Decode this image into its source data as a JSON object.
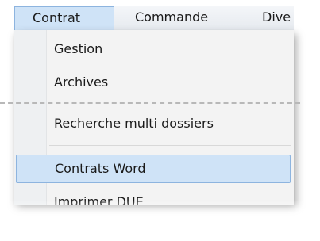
{
  "menubar": {
    "items": [
      {
        "label": "Contrat",
        "active": true
      },
      {
        "label": "Commande",
        "active": false
      },
      {
        "label": "Dive",
        "active": false
      }
    ]
  },
  "dropdown": {
    "items": [
      {
        "label": "Gestion"
      },
      {
        "label": "Archives"
      },
      {
        "label": "Recherche multi dossiers"
      },
      {
        "label": "Contrats Word",
        "highlighted": true
      },
      {
        "label": "Imprimer DUE"
      }
    ]
  },
  "colors": {
    "highlight_fill": "#cfe3f7",
    "highlight_border": "#8db4df",
    "menu_background": "#f3f3f3"
  }
}
